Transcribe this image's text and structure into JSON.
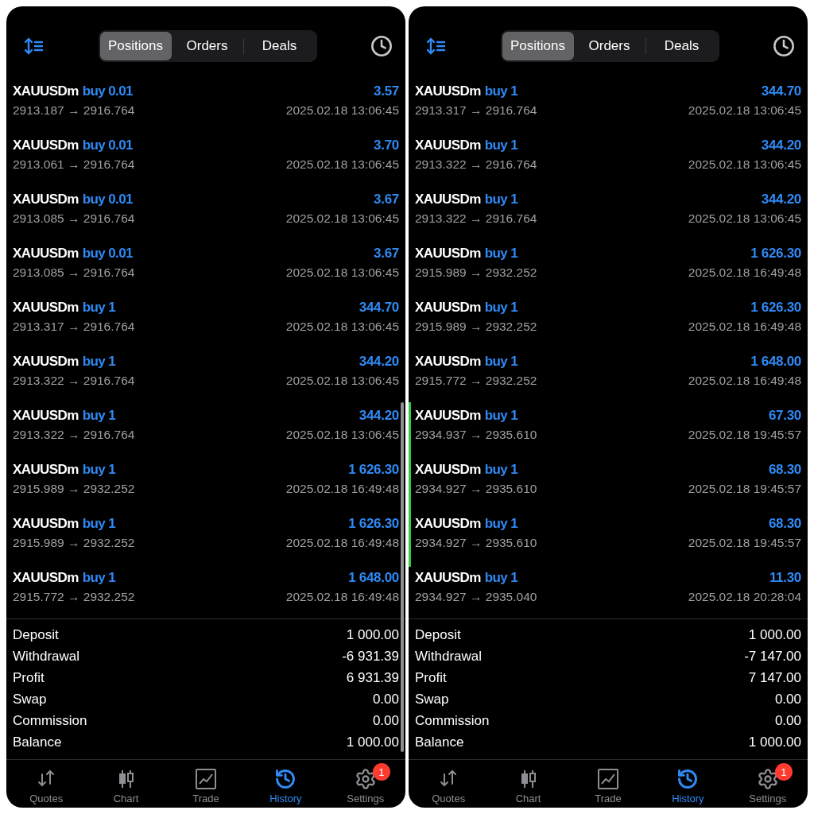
{
  "panels": [
    {
      "tabs": [
        {
          "label": "Positions",
          "selected": true
        },
        {
          "label": "Orders",
          "selected": false
        },
        {
          "label": "Deals",
          "selected": false
        }
      ],
      "rows": [
        {
          "symbol": "XAUUSDm",
          "order": "buy 0.01",
          "profit": "3.57",
          "prices": "2913.187 → 2916.764",
          "time": "2025.02.18 13:06:45"
        },
        {
          "symbol": "XAUUSDm",
          "order": "buy 0.01",
          "profit": "3.70",
          "prices": "2913.061 → 2916.764",
          "time": "2025.02.18 13:06:45"
        },
        {
          "symbol": "XAUUSDm",
          "order": "buy 0.01",
          "profit": "3.67",
          "prices": "2913.085 → 2916.764",
          "time": "2025.02.18 13:06:45"
        },
        {
          "symbol": "XAUUSDm",
          "order": "buy 0.01",
          "profit": "3.67",
          "prices": "2913.085 → 2916.764",
          "time": "2025.02.18 13:06:45"
        },
        {
          "symbol": "XAUUSDm",
          "order": "buy 1",
          "profit": "344.70",
          "prices": "2913.317 → 2916.764",
          "time": "2025.02.18 13:06:45"
        },
        {
          "symbol": "XAUUSDm",
          "order": "buy 1",
          "profit": "344.20",
          "prices": "2913.322 → 2916.764",
          "time": "2025.02.18 13:06:45"
        },
        {
          "symbol": "XAUUSDm",
          "order": "buy 1",
          "profit": "344.20",
          "prices": "2913.322 → 2916.764",
          "time": "2025.02.18 13:06:45"
        },
        {
          "symbol": "XAUUSDm",
          "order": "buy 1",
          "profit": "1 626.30",
          "prices": "2915.989 → 2932.252",
          "time": "2025.02.18 16:49:48"
        },
        {
          "symbol": "XAUUSDm",
          "order": "buy 1",
          "profit": "1 626.30",
          "prices": "2915.989 → 2932.252",
          "time": "2025.02.18 16:49:48"
        },
        {
          "symbol": "XAUUSDm",
          "order": "buy 1",
          "profit": "1 648.00",
          "prices": "2915.772 → 2932.252",
          "time": "2025.02.18 16:49:48"
        }
      ],
      "summary": [
        {
          "label": "Deposit",
          "value": "1 000.00"
        },
        {
          "label": "Withdrawal",
          "value": "-6 931.39"
        },
        {
          "label": "Profit",
          "value": "6 931.39"
        },
        {
          "label": "Swap",
          "value": "0.00"
        },
        {
          "label": "Commission",
          "value": "0.00"
        },
        {
          "label": "Balance",
          "value": "1 000.00"
        }
      ],
      "nav": [
        {
          "label": "Quotes",
          "selected": false
        },
        {
          "label": "Chart",
          "selected": false
        },
        {
          "label": "Trade",
          "selected": false
        },
        {
          "label": "History",
          "selected": true
        },
        {
          "label": "Settings",
          "selected": false,
          "badge": "1"
        }
      ]
    },
    {
      "tabs": [
        {
          "label": "Positions",
          "selected": true
        },
        {
          "label": "Orders",
          "selected": false
        },
        {
          "label": "Deals",
          "selected": false
        }
      ],
      "rows": [
        {
          "symbol": "XAUUSDm",
          "order": "buy 1",
          "profit": "344.70",
          "prices": "2913.317 → 2916.764",
          "time": "2025.02.18 13:06:45"
        },
        {
          "symbol": "XAUUSDm",
          "order": "buy 1",
          "profit": "344.20",
          "prices": "2913.322 → 2916.764",
          "time": "2025.02.18 13:06:45"
        },
        {
          "symbol": "XAUUSDm",
          "order": "buy 1",
          "profit": "344.20",
          "prices": "2913.322 → 2916.764",
          "time": "2025.02.18 13:06:45"
        },
        {
          "symbol": "XAUUSDm",
          "order": "buy 1",
          "profit": "1 626.30",
          "prices": "2915.989 → 2932.252",
          "time": "2025.02.18 16:49:48"
        },
        {
          "symbol": "XAUUSDm",
          "order": "buy 1",
          "profit": "1 626.30",
          "prices": "2915.989 → 2932.252",
          "time": "2025.02.18 16:49:48"
        },
        {
          "symbol": "XAUUSDm",
          "order": "buy 1",
          "profit": "1 648.00",
          "prices": "2915.772 → 2932.252",
          "time": "2025.02.18 16:49:48"
        },
        {
          "symbol": "XAUUSDm",
          "order": "buy 1",
          "profit": "67.30",
          "prices": "2934.937 → 2935.610",
          "time": "2025.02.18 19:45:57"
        },
        {
          "symbol": "XAUUSDm",
          "order": "buy 1",
          "profit": "68.30",
          "prices": "2934.927 → 2935.610",
          "time": "2025.02.18 19:45:57"
        },
        {
          "symbol": "XAUUSDm",
          "order": "buy 1",
          "profit": "68.30",
          "prices": "2934.927 → 2935.610",
          "time": "2025.02.18 19:45:57"
        },
        {
          "symbol": "XAUUSDm",
          "order": "buy 1",
          "profit": "11.30",
          "prices": "2934.927 → 2935.040",
          "time": "2025.02.18 20:28:04"
        }
      ],
      "summary": [
        {
          "label": "Deposit",
          "value": "1 000.00"
        },
        {
          "label": "Withdrawal",
          "value": "-7 147.00"
        },
        {
          "label": "Profit",
          "value": "7 147.00"
        },
        {
          "label": "Swap",
          "value": "0.00"
        },
        {
          "label": "Commission",
          "value": "0.00"
        },
        {
          "label": "Balance",
          "value": "1 000.00"
        }
      ],
      "nav": [
        {
          "label": "Quotes",
          "selected": false
        },
        {
          "label": "Chart",
          "selected": false
        },
        {
          "label": "Trade",
          "selected": false
        },
        {
          "label": "History",
          "selected": true
        },
        {
          "label": "Settings",
          "selected": false,
          "badge": "1"
        }
      ]
    }
  ]
}
